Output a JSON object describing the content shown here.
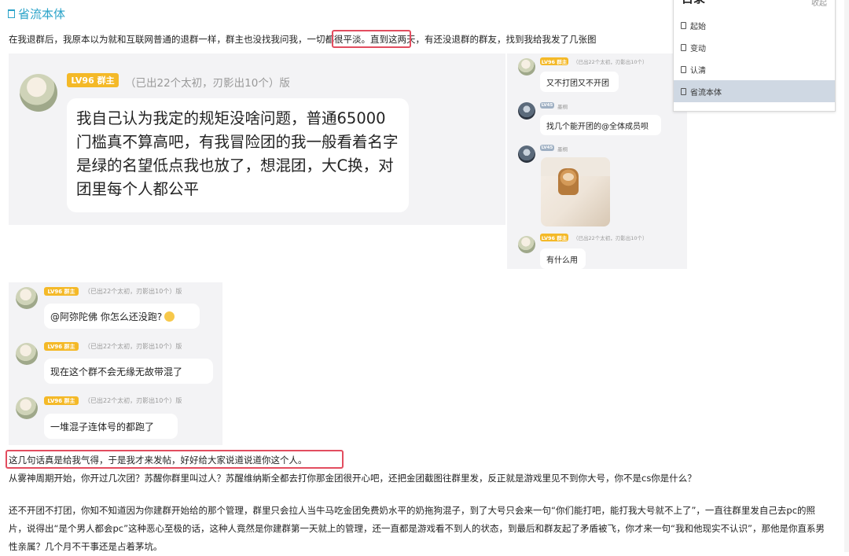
{
  "section": {
    "title": "省流本体",
    "icon": "bookmark-icon"
  },
  "para1": "在我退群后，我原本以为就和互联网普通的退群一样，群主也没找我问我，一切都很平淡。直到这两天，有还没退群的群友，找到我给我发了几张图",
  "screenshot1": {
    "main": {
      "badge_lv": "LV96",
      "badge_role": "群主",
      "meta": "（已出22个太初，刃影出10个）版",
      "message": "我自己认为我定的规矩没啥问题，普通65000门槛真不算高吧，有我冒险团的我一般看着名字是绿的名望低点我也放了，想混团，大C换，对团里每个人都公平"
    },
    "right_chat": [
      {
        "badge": "LV96 群主",
        "meta": "（已出22个太初，刃影出10个）",
        "text": "又不打团又不开团"
      },
      {
        "badge": "LV45",
        "meta": "墨桐",
        "text": "找几个能开团的@全体成员呗"
      },
      {
        "badge": "LV45",
        "meta": "墨桐",
        "text": ""
      },
      {
        "badge": "LV96 群主",
        "meta": "（已出22个太初，刃影出10个）",
        "text": "有什么用"
      }
    ]
  },
  "screenshot2": {
    "messages": [
      {
        "badge_lv": "LV96",
        "badge_role": "群主",
        "meta": "（已出22个太初，刃影出10个）版",
        "text": "@阿弥陀佛 你怎么还没跑?"
      },
      {
        "badge_lv": "LV96",
        "badge_role": "群主",
        "meta": "（已出22个太初，刃影出10个）版",
        "text": "现在这个群不会无缘无故带混了"
      },
      {
        "badge_lv": "LV96",
        "badge_role": "群主",
        "meta": "（已出22个太初，刃影出10个）版",
        "text": "一堆混子连体号的都跑了"
      }
    ]
  },
  "para2": "这几句话真是给我气得，于是我才来发帖，好好给大家说道说道你这个人。",
  "para3": "从雾神周期开始，你开过几次团？苏醒你群里叫过人？苏醒维纳斯全都去打你那金团很开心吧，还把金团截图往群里发，反正就是游戏里见不到你大号，你不是cs你是什么？",
  "para4": "还不开团不打团，你知不知道因为你建群开始给的那个管理，群里只会拉人当牛马吃金团免费奶水平的奶拖狗混子，到了大号只会来一句“你们能打吧，能打我大号就不上了”，一直往群里发自己去pc的照片，说得出“是个男人都会pc”这种恶心至极的话，这种人竟然是你建群第一天就上的管理，还一直都是游戏看不到人的状态，到最后和群友起了矛盾被飞，你才来一句“我和他现实不认识”，那他是你直系男性亲属？几个月不干事还是占着茅坑。",
  "toc": {
    "title": "目录",
    "collapse": "收起",
    "items": [
      "起始",
      "变动",
      "认清",
      "省流本体"
    ],
    "active_index": 3
  }
}
